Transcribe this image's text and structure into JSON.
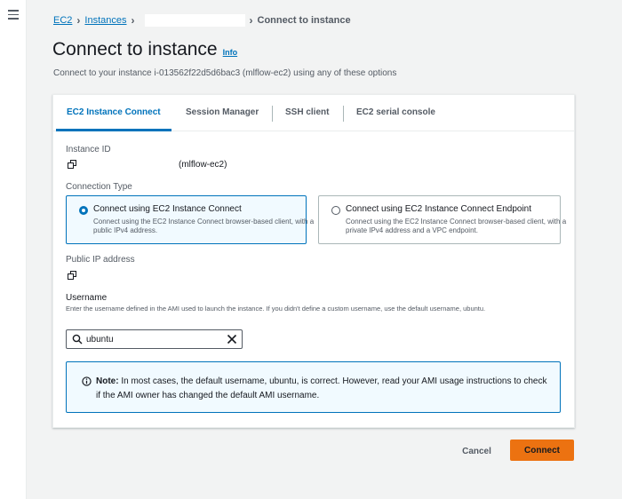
{
  "nav": {
    "menu_icon": "hamburger-menu-icon"
  },
  "breadcrumb": {
    "ec2": "EC2",
    "instances": "Instances",
    "current": "Connect to instance"
  },
  "header": {
    "title": "Connect to instance",
    "info": "Info",
    "description": "Connect to your instance i-013562f22d5d6bac3 (mlflow-ec2) using any of these options"
  },
  "tabs": [
    {
      "label": "EC2 Instance Connect",
      "active": true
    },
    {
      "label": "Session Manager",
      "active": false
    },
    {
      "label": "SSH client",
      "active": false
    },
    {
      "label": "EC2 serial console",
      "active": false
    }
  ],
  "instance": {
    "id_label": "Instance ID",
    "name": "(mlflow-ec2)"
  },
  "connection_type": {
    "label": "Connection Type",
    "options": [
      {
        "title": "Connect using EC2 Instance Connect",
        "description": "Connect using the EC2 Instance Connect browser-based client, with a public IPv4 address.",
        "selected": true
      },
      {
        "title": "Connect using EC2 Instance Connect Endpoint",
        "description": "Connect using the EC2 Instance Connect browser-based client, with a private IPv4 address and a VPC endpoint.",
        "selected": false
      }
    ]
  },
  "public_ip": {
    "label": "Public IP address"
  },
  "username": {
    "label": "Username",
    "hint": "Enter the username defined in the AMI used to launch the instance. If you didn't define a custom username, use the default username, ubuntu.",
    "value": "ubuntu"
  },
  "note": {
    "bold": "Note:",
    "text": " In most cases, the default username, ubuntu, is correct. However, read your AMI usage instructions to check if the AMI owner has changed the default AMI username."
  },
  "actions": {
    "cancel": "Cancel",
    "connect": "Connect"
  },
  "colors": {
    "accent": "#0073bb",
    "primary_button": "#ec7211",
    "note_background": "#f1faff"
  }
}
